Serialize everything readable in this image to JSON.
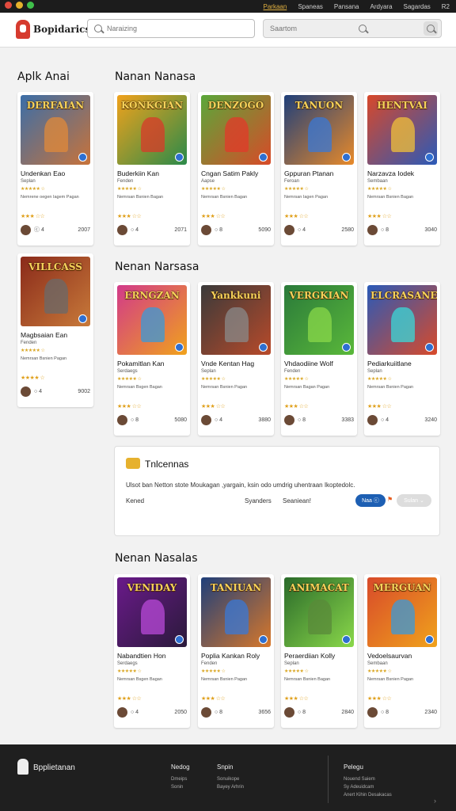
{
  "topnav": [
    "Parkaan",
    "Spaneas",
    "Pansana",
    "Ardyara",
    "Sagardas",
    "R2"
  ],
  "brand": "Bopidarics",
  "search": {
    "placeholder_1": "Naraizing",
    "placeholder_2": "Saartom"
  },
  "sections": {
    "left_heading": "Aplk Anai",
    "row1_heading": "Nanan Nanasa",
    "row2_heading": "Nenan Narsasa",
    "row3_heading": "Nenan Nasalas"
  },
  "cards": [
    {
      "banner": "DERFAIAN",
      "title": "Undenkan Eao",
      "sub": "Seplan",
      "stars1": "★★★★★ ☆",
      "desc": "Nemrene oegen Iagem Pagan",
      "stars2": "★★★ ☆☆",
      "foot": "ⓒ 4",
      "num": "2007",
      "c1": "#3b6ea8",
      "c2": "#c8733a",
      "glow": "#e08a3a"
    },
    {
      "banner": "KONKGIAN",
      "title": "Buderkiin Kan",
      "sub": "Fenden",
      "stars1": "★★★★★ ☆",
      "desc": "Nemrsan Bsnien Bagan",
      "stars2": "★★★ ☆☆",
      "foot": "○ 4",
      "num": "2071",
      "c1": "#f0a21c",
      "c2": "#2a8a4a",
      "glow": "#d83a2a"
    },
    {
      "banner": "DENZOGO",
      "title": "Cngan Satim Pakly",
      "sub": "Aapse",
      "stars1": "★★★★★ ☆",
      "desc": "Nemrsan Bsnien Bagan",
      "stars2": "★★★ ☆☆",
      "foot": "○ 8",
      "num": "5090",
      "c1": "#5aa83a",
      "c2": "#d84a28",
      "glow": "#e23a2a"
    },
    {
      "banner": "TANUON",
      "title": "Gppuran Ptanan",
      "sub": "Feroan",
      "stars1": "★★★★★ ☆",
      "desc": "Nemrsan Iagen Pagan",
      "stars2": "★★★ ☆☆",
      "foot": "○ 4",
      "num": "2580",
      "c1": "#1f3f7a",
      "c2": "#e88a2a",
      "glow": "#3a78d6"
    },
    {
      "banner": "HENTVAI",
      "title": "Narzavza Iodek",
      "sub": "Sembaan",
      "stars1": "★★★★★ ☆",
      "desc": "Nemrsan Bsnien Bagan",
      "stars2": "★★★ ☆☆",
      "foot": "○ 8",
      "num": "3040",
      "c1": "#d8482a",
      "c2": "#2a5ab8",
      "glow": "#f0c03a"
    },
    {
      "banner": "VILLCASS",
      "title": "Magbsaian Ean",
      "sub": "Fenden",
      "stars1": "★★★★★ ☆",
      "desc": "Nemrsan Bsnien Pagan",
      "stars2": "★★★★ ☆",
      "foot": "○ 4",
      "num": "9002",
      "c1": "#8a2a1a",
      "c2": "#c87a3a",
      "glow": "#6a6a6a"
    },
    {
      "banner": "ERNGZAN",
      "title": "Pokamitlan Kan",
      "sub": "Serdaegs",
      "stars1": "★★★★★ ☆",
      "desc": "Nemrsan Bsgen Bagan",
      "stars2": "★★★ ☆☆",
      "foot": "○ 8",
      "num": "5080",
      "c1": "#d23a8a",
      "c2": "#f0a21c",
      "glow": "#3a9ad8"
    },
    {
      "banner": "Yankkuni",
      "title": "Vnde Kentan Hag",
      "sub": "Seplan",
      "stars1": "★★★★★ ☆",
      "desc": "Nemrsan Bsnien Pagan",
      "stars2": "★★★ ☆☆",
      "foot": "○ 4",
      "num": "3880",
      "c1": "#3a3a3a",
      "c2": "#b84a2a",
      "glow": "#8a8a8a"
    },
    {
      "banner": "VERGKIAN",
      "title": "Vhdaodiine Wolf",
      "sub": "Fenden",
      "stars1": "★★★★★ ☆",
      "desc": "Nemrsan Bagan Pagan",
      "stars2": "★★★ ☆☆",
      "foot": "○ 8",
      "num": "3383",
      "c1": "#2a7a3a",
      "c2": "#5ab83a",
      "glow": "#8ad84a"
    },
    {
      "banner": "ELCRASANE",
      "title": "Pediarkuiitlane",
      "sub": "Seplan",
      "stars1": "★★★★★ ☆",
      "desc": "Nemrsan Bsnien Pagan",
      "stars2": "★★★ ☆☆",
      "foot": "○ 4",
      "num": "3240",
      "c1": "#2a5ab8",
      "c2": "#d84a2a",
      "glow": "#3ad8d8"
    },
    {
      "banner": "VENIDAY",
      "title": "Nabandtien Hon",
      "sub": "Serdaegs",
      "stars1": "★★★★★ ☆",
      "desc": "Nemrsan Bsgen Bagan",
      "stars2": "★★★ ☆☆",
      "foot": "○ 4",
      "num": "2050",
      "c1": "#6a1a8a",
      "c2": "#2a1a3a",
      "glow": "#b84ad8"
    },
    {
      "banner": "TANIUAN",
      "title": "Poplia Kankan Roly",
      "sub": "Fenden",
      "stars1": "★★★★★ ☆",
      "desc": "Nemrsan Bsnien Pagan",
      "stars2": "★★★ ☆☆",
      "foot": "○ 8",
      "num": "3656",
      "c1": "#1f3f7a",
      "c2": "#d8782a",
      "glow": "#3a78d6"
    },
    {
      "banner": "ANIMACAT",
      "title": "Peraerdiian Kolly",
      "sub": "Seplan",
      "stars1": "★★★★★ ☆",
      "desc": "Nemrsan Bsnien Bagan",
      "stars2": "★★★ ☆☆",
      "foot": "○ 8",
      "num": "2840",
      "c1": "#2a6a2a",
      "c2": "#8ad84a",
      "glow": "#5a8a3a"
    },
    {
      "banner": "MERGUAN",
      "title": "Vedoelsaurvan",
      "sub": "Sembaan",
      "stars1": "★★★★★ ☆",
      "desc": "Nemrsan Bsnien Pagan",
      "stars2": "★★★ ☆☆",
      "foot": "○ 8",
      "num": "2340",
      "c1": "#d84a2a",
      "c2": "#f0a21c",
      "glow": "#3a9ad8"
    }
  ],
  "panel": {
    "title": "Tnlcennas",
    "desc": "Ulsot ban Netton stote Moukagan ,yargain, ksin odo umdrig uhentraan Ikoptedolc.",
    "a": "Kened",
    "b": "Syanders",
    "c": "Seaniean!",
    "btn_blue": "Naa ⓒ",
    "btn_grey": "Sulan ⌄"
  },
  "footer": {
    "brand": "Bpplietanan",
    "col1": {
      "head": "Nedog",
      "items": [
        "Dmeips",
        "Sonin"
      ]
    },
    "col2": {
      "head": "Snpin",
      "items": [
        "Sonuikope",
        "Bayey Arhrin"
      ]
    },
    "col3": {
      "head": "Pelegu",
      "items": [
        "Nouend Saiem",
        "Sy Adeuidcam",
        "Anert Kihin Desakacas"
      ]
    }
  },
  "colors": {
    "accent": "#1d5fb3",
    "brand_red": "#d63b2f",
    "star": "#d9a520"
  }
}
